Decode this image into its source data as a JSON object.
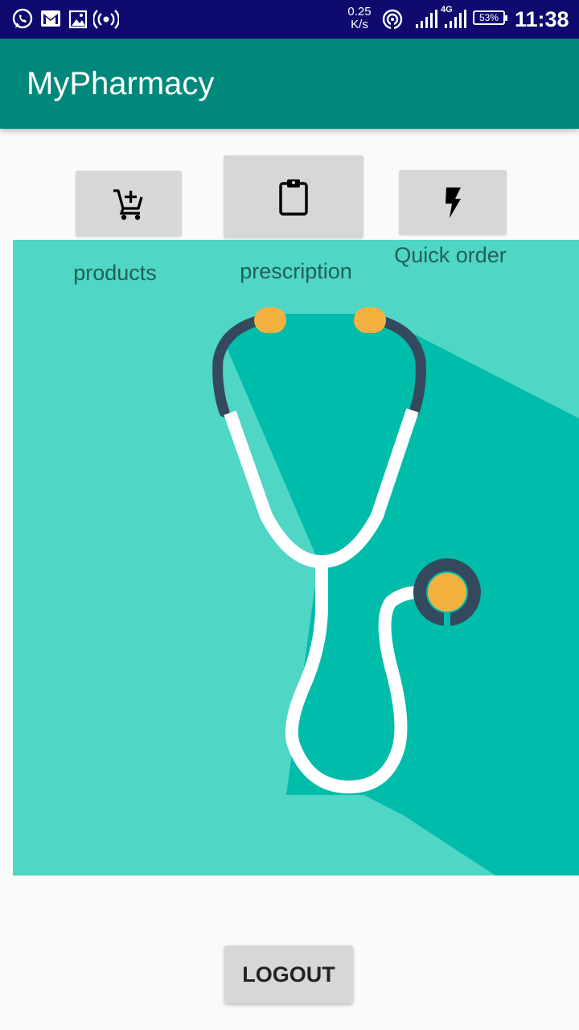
{
  "status_bar": {
    "speed_value": "0.25",
    "speed_unit": "K/s",
    "network_label": "4G",
    "battery": "53%",
    "time": "11:38",
    "icons": [
      "whatsapp-icon",
      "gmail-icon",
      "gallery-icon",
      "hotspot-icon",
      "wifi-icon",
      "signal-icon",
      "signal-4g-icon",
      "battery-icon"
    ]
  },
  "app_bar": {
    "title": "MyPharmacy"
  },
  "actions": {
    "products": {
      "label": "products",
      "icon": "add-to-cart-icon"
    },
    "prescription": {
      "label": "prescription",
      "icon": "clipboard-icon"
    },
    "quick_order": {
      "label": "Quick order",
      "icon": "flash-icon"
    }
  },
  "hero": {
    "illustration": "stethoscope-icon",
    "colors": {
      "background": "#4fd6c4",
      "shadow": "#00bcaa",
      "tube": "#ffffff",
      "dark": "#34495e",
      "accent": "#f3b23f"
    }
  },
  "logout": {
    "label": "LOGOUT"
  }
}
